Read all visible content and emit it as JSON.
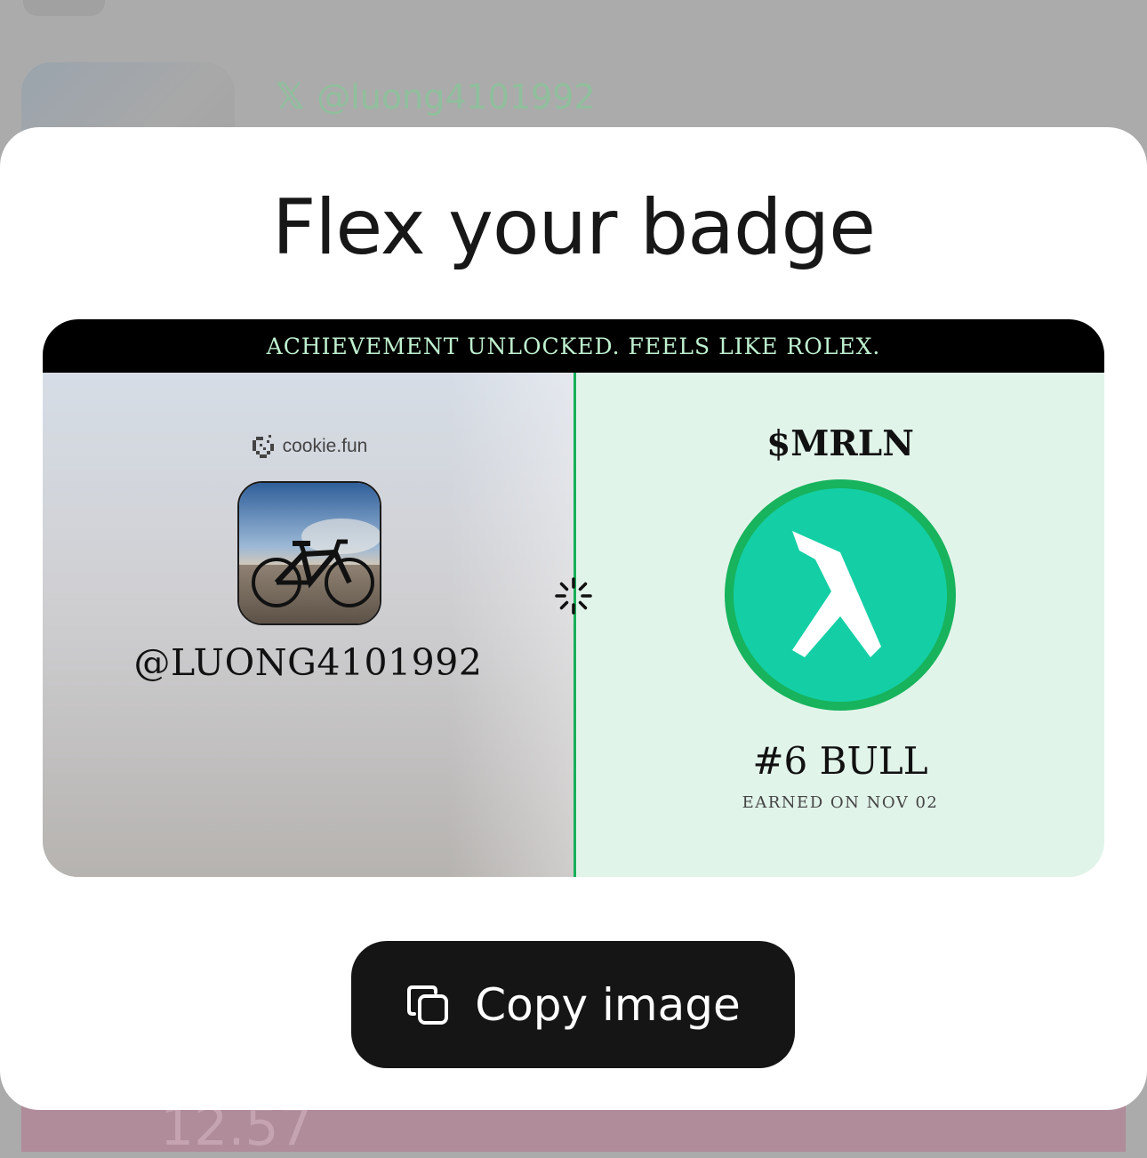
{
  "background": {
    "handle": "@luong4101992",
    "x_icon": "x-logo-icon",
    "bottom_text": "12.57"
  },
  "modal": {
    "title": "Flex your badge"
  },
  "badge": {
    "banner": "ACHIEVEMENT  UNLOCKED.  FEELS  LIKE  ROLEX.",
    "brand": "cookie.fun",
    "username": "@LUONG4101992",
    "ticker": "$MRLN",
    "rank": "#6 BULL",
    "earned": "EARNED  ON  NOV  02"
  },
  "actions": {
    "copy_label": "Copy image"
  },
  "colors": {
    "accent_green": "#17b058",
    "token_green": "#14cfa5",
    "banner_text": "#bff0cf",
    "button_bg": "#151515"
  }
}
